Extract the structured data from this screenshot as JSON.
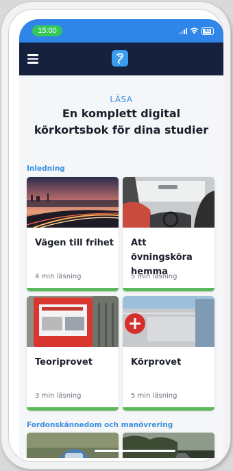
{
  "status_bar": {
    "time": "15:00",
    "battery": "61",
    "bg": "#2f86e8",
    "time_pill_color": "#34c759"
  },
  "header": {
    "menu_icon": "hamburger-menu-icon",
    "logo": "app-logo-icon",
    "bg": "#16213e"
  },
  "hero": {
    "eyebrow": "LÄSA",
    "headline": "En komplett digital körkortsbok för dina studier"
  },
  "sections": [
    {
      "label": "Inledning",
      "cards": [
        {
          "title": "Vägen till frihet",
          "meta": "4 min läsning",
          "image": "city-night-traffic-image"
        },
        {
          "title": "Att övningsköra hemma",
          "meta": "5 min läsning",
          "image": "car-interior-driving-image"
        },
        {
          "title": "Teoriprovet",
          "meta": "3 min läsning",
          "image": "forarprov-sign-image"
        },
        {
          "title": "Körprovet",
          "meta": "5 min läsning",
          "image": "forarprov-building-image"
        }
      ]
    },
    {
      "label": "Fordonskännedom och manövrering",
      "cards": [
        {
          "title": "",
          "meta": "",
          "image": "vintage-car-image"
        },
        {
          "title": "",
          "meta": "",
          "image": "road-trees-image"
        }
      ]
    }
  ],
  "colors": {
    "accent": "#3a8fe0",
    "progress": "#5cb85c",
    "text": "#1b1f2a"
  }
}
